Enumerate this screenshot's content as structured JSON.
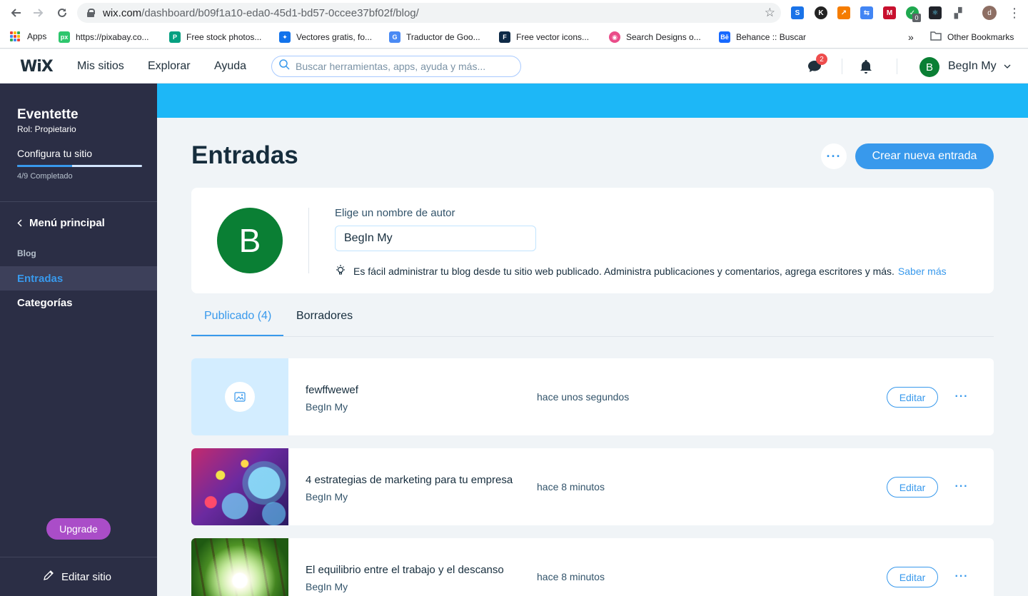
{
  "browser": {
    "url_host": "wix.com",
    "url_path": "/dashboard/b09f1a10-eda0-45d1-bd57-0ccee37bf02f/blog/",
    "profile_initial": "d",
    "extension_badge": "0",
    "bookmarks": [
      {
        "label": "Apps",
        "icon": "apps-grid-icon"
      },
      {
        "label": "https://pixabay.co...",
        "icon": "pixabay-icon",
        "icon_text": "px",
        "color": "#2ec66d"
      },
      {
        "label": "Free stock photos...",
        "icon": "pexels-icon",
        "icon_text": "P",
        "color": "#05a081"
      },
      {
        "label": "Vectores gratis, fo...",
        "icon": "freepik-icon",
        "icon_text": "✦",
        "color": "#1273eb"
      },
      {
        "label": "Traductor de Goo...",
        "icon": "google-translate-icon",
        "icon_text": "G",
        "color": "#4a8af4"
      },
      {
        "label": "Free vector icons...",
        "icon": "flaticon-icon",
        "icon_text": "F",
        "color": "#0e2a47"
      },
      {
        "label": "Search Designs o...",
        "icon": "dribbble-icon",
        "icon_text": "◉",
        "color": "#ea4c89"
      },
      {
        "label": "Behance :: Buscar",
        "icon": "behance-icon",
        "icon_text": "Bē",
        "color": "#1769ff"
      }
    ],
    "other_bookmarks": "Other Bookmarks",
    "overflow": "»"
  },
  "wix": {
    "logo": "WiX",
    "nav": [
      "Mis sitios",
      "Explorar",
      "Ayuda"
    ],
    "search_placeholder": "Buscar herramientas, apps, ayuda y más...",
    "chat_badge": "2",
    "user_initial": "B",
    "user_name": "BegIn My"
  },
  "sidebar": {
    "site_name": "Eventette",
    "role": "Rol: Propietario",
    "setup_label": "Configura tu sitio",
    "setup_progress": "4/9 Completado",
    "setup_fraction": 0.44,
    "main_menu": "Menú principal",
    "section": "Blog",
    "items": [
      {
        "label": "Entradas",
        "active": true
      },
      {
        "label": "Categorías",
        "active": false
      }
    ],
    "upgrade": "Upgrade",
    "edit_site": "Editar sitio"
  },
  "page": {
    "title": "Entradas",
    "more": "···",
    "create_button": "Crear nueva entrada",
    "author_card": {
      "avatar_initial": "B",
      "label": "Elige un nombre de autor",
      "value": "BegIn My",
      "tip": "Es fácil administrar tu blog desde tu sitio web publicado. Administra publicaciones y comentarios, agrega escritores y más.",
      "tip_link": "Saber más"
    },
    "tabs": [
      {
        "label": "Publicado (4)",
        "active": true
      },
      {
        "label": "Borradores",
        "active": false
      }
    ],
    "posts": [
      {
        "title": "fewffwewef",
        "author": "BegIn My",
        "time": "hace unos segundos",
        "edit": "Editar",
        "thumb": "placeholder"
      },
      {
        "title": "4 estrategias de marketing para tu empresa",
        "author": "BegIn My",
        "time": "hace 8 minutos",
        "edit": "Editar",
        "thumb": "bubbles"
      },
      {
        "title": "El equilibrio entre el trabajo y el descanso",
        "author": "BegIn My",
        "time": "hace 8 minutos",
        "edit": "Editar",
        "thumb": "forest"
      }
    ]
  }
}
